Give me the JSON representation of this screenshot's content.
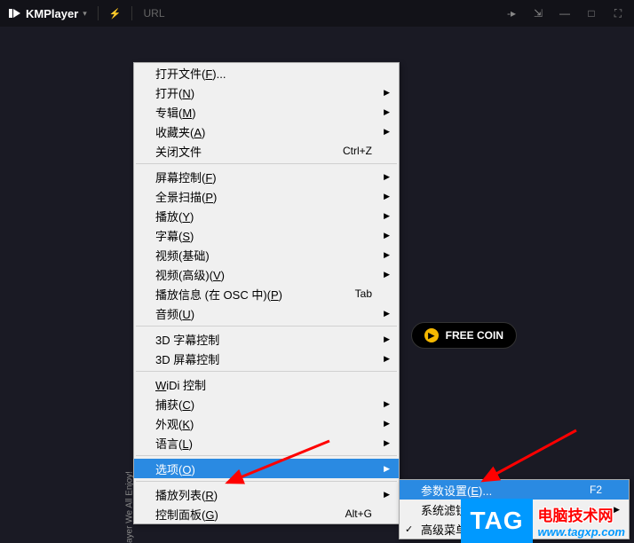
{
  "app": {
    "title": "KMPlayer",
    "url_label": "URL"
  },
  "free_coin": {
    "label": "FREE COIN"
  },
  "bg_text": "r",
  "menu": {
    "items": [
      {
        "label": "打开文件(F)...",
        "uchar": "F"
      },
      {
        "label": "打开(N)",
        "uchar": "N",
        "submenu": true
      },
      {
        "label": "专辑(M)",
        "uchar": "M",
        "submenu": true
      },
      {
        "label": "收藏夹(A)",
        "uchar": "A",
        "submenu": true
      },
      {
        "label": "关闭文件",
        "shortcut": "Ctrl+Z"
      },
      {
        "sep": true
      },
      {
        "label": "屏幕控制(F)",
        "uchar": "F",
        "submenu": true
      },
      {
        "label": "全景扫描(P)",
        "uchar": "P",
        "submenu": true
      },
      {
        "label": "播放(Y)",
        "uchar": "Y",
        "submenu": true
      },
      {
        "label": "字幕(S)",
        "uchar": "S",
        "submenu": true
      },
      {
        "label": "视频(基础)",
        "submenu": true
      },
      {
        "label": "视频(高级)(V)",
        "uchar": "V",
        "submenu": true
      },
      {
        "label": "播放信息 (在 OSC 中)(P)",
        "uchar": "P",
        "shortcut": "Tab"
      },
      {
        "label": "音频(U)",
        "uchar": "U",
        "submenu": true
      },
      {
        "sep": true
      },
      {
        "label": "3D 字幕控制",
        "submenu": true
      },
      {
        "label": "3D 屏幕控制",
        "submenu": true
      },
      {
        "sep": true
      },
      {
        "label": "WiDi 控制",
        "uchar": "W"
      },
      {
        "label": "捕获(C)",
        "uchar": "C",
        "submenu": true
      },
      {
        "label": "外观(K)",
        "uchar": "K",
        "submenu": true
      },
      {
        "label": "语言(L)",
        "uchar": "L",
        "submenu": true
      },
      {
        "sep": true
      },
      {
        "label": "选项(O)",
        "uchar": "O",
        "submenu": true,
        "highlighted": true
      },
      {
        "sep": true
      },
      {
        "label": "播放列表(R)",
        "uchar": "R",
        "submenu": true
      },
      {
        "label": "控制面板(G)",
        "uchar": "G",
        "shortcut": "Alt+G"
      }
    ]
  },
  "submenu": {
    "items": [
      {
        "label": "参数设置(E)...",
        "uchar": "E",
        "shortcut": "F2",
        "highlighted": true
      },
      {
        "label": "系统滤镜",
        "submenu": true
      },
      {
        "label": "高级菜单",
        "checked": true
      }
    ]
  },
  "sidebar_text": "ayer We All Enjoy!",
  "watermark": {
    "tag": "TAG",
    "cn": "电脑技术网",
    "url": "www.tagxp.com"
  }
}
